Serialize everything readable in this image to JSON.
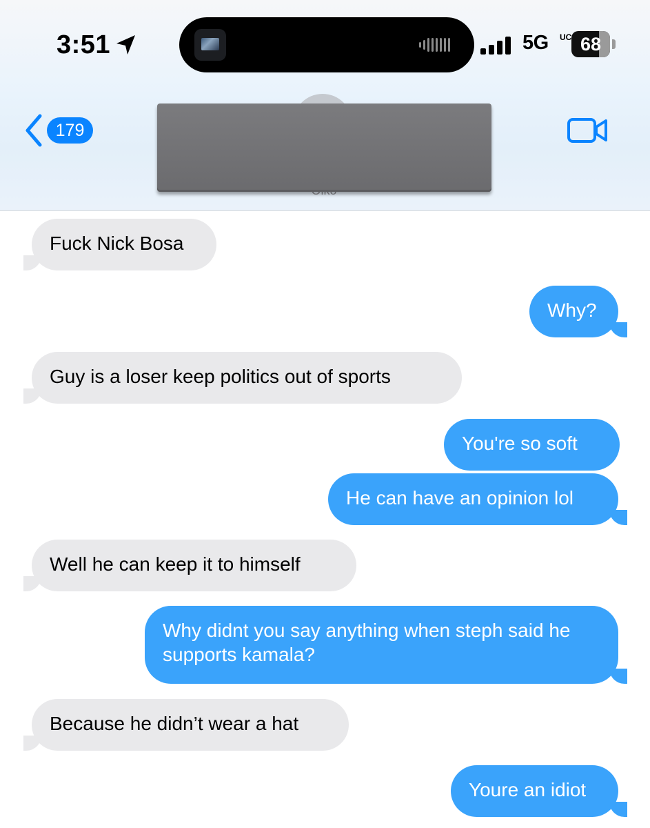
{
  "status_bar": {
    "time": "3:51",
    "network": "5G",
    "network_suffix": "UC",
    "battery": "68"
  },
  "nav": {
    "back_badge": "179",
    "contact_subtitle": "Oiko"
  },
  "colors": {
    "accent": "#0a84ff",
    "outgoing_bubble": "#3aa3fb",
    "incoming_bubble": "#e9e9eb"
  },
  "messages": [
    {
      "direction": "incoming",
      "text": "Fuck Nick Bosa"
    },
    {
      "direction": "outgoing",
      "text": "Why?"
    },
    {
      "direction": "incoming",
      "text": "Guy is a loser keep politics out of sports"
    },
    {
      "direction": "outgoing",
      "text": "You're so soft"
    },
    {
      "direction": "outgoing",
      "text": "He can have an opinion lol"
    },
    {
      "direction": "incoming",
      "text": "Well he can keep it to himself"
    },
    {
      "direction": "outgoing",
      "text": "Why didnt you say anything when steph said he supports kamala?"
    },
    {
      "direction": "incoming",
      "text": "Because he didn’t wear a hat"
    },
    {
      "direction": "outgoing",
      "text": "Youre an idiot"
    }
  ]
}
